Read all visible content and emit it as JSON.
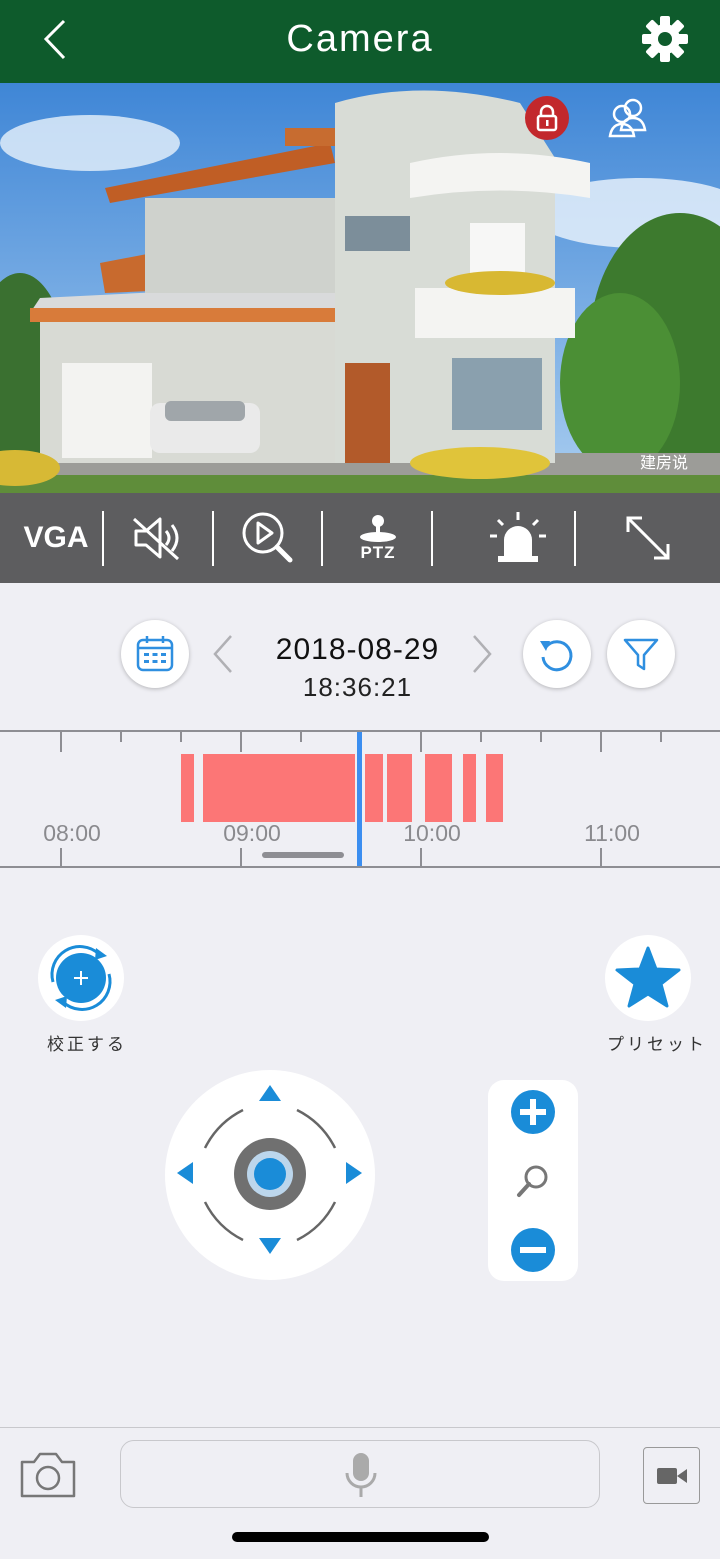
{
  "nav": {
    "title": "Camera"
  },
  "video": {
    "watermark": "建房说"
  },
  "toolbar": {
    "resolution": "VGA",
    "ptz_label": "PTZ"
  },
  "playback": {
    "date": "2018-08-29",
    "time": "18:36:21"
  },
  "timeline": {
    "labels": [
      "08:00",
      "09:00",
      "10:00",
      "11:00"
    ]
  },
  "controls": {
    "calibrate_label": "校正する",
    "preset_label": "プリセット"
  },
  "colors": {
    "nav": "#0e5b2c",
    "accent": "#1a8cd8",
    "record": "#fc7676",
    "toolbar": "#5d5d5f",
    "playhead": "#3b8ef0"
  }
}
